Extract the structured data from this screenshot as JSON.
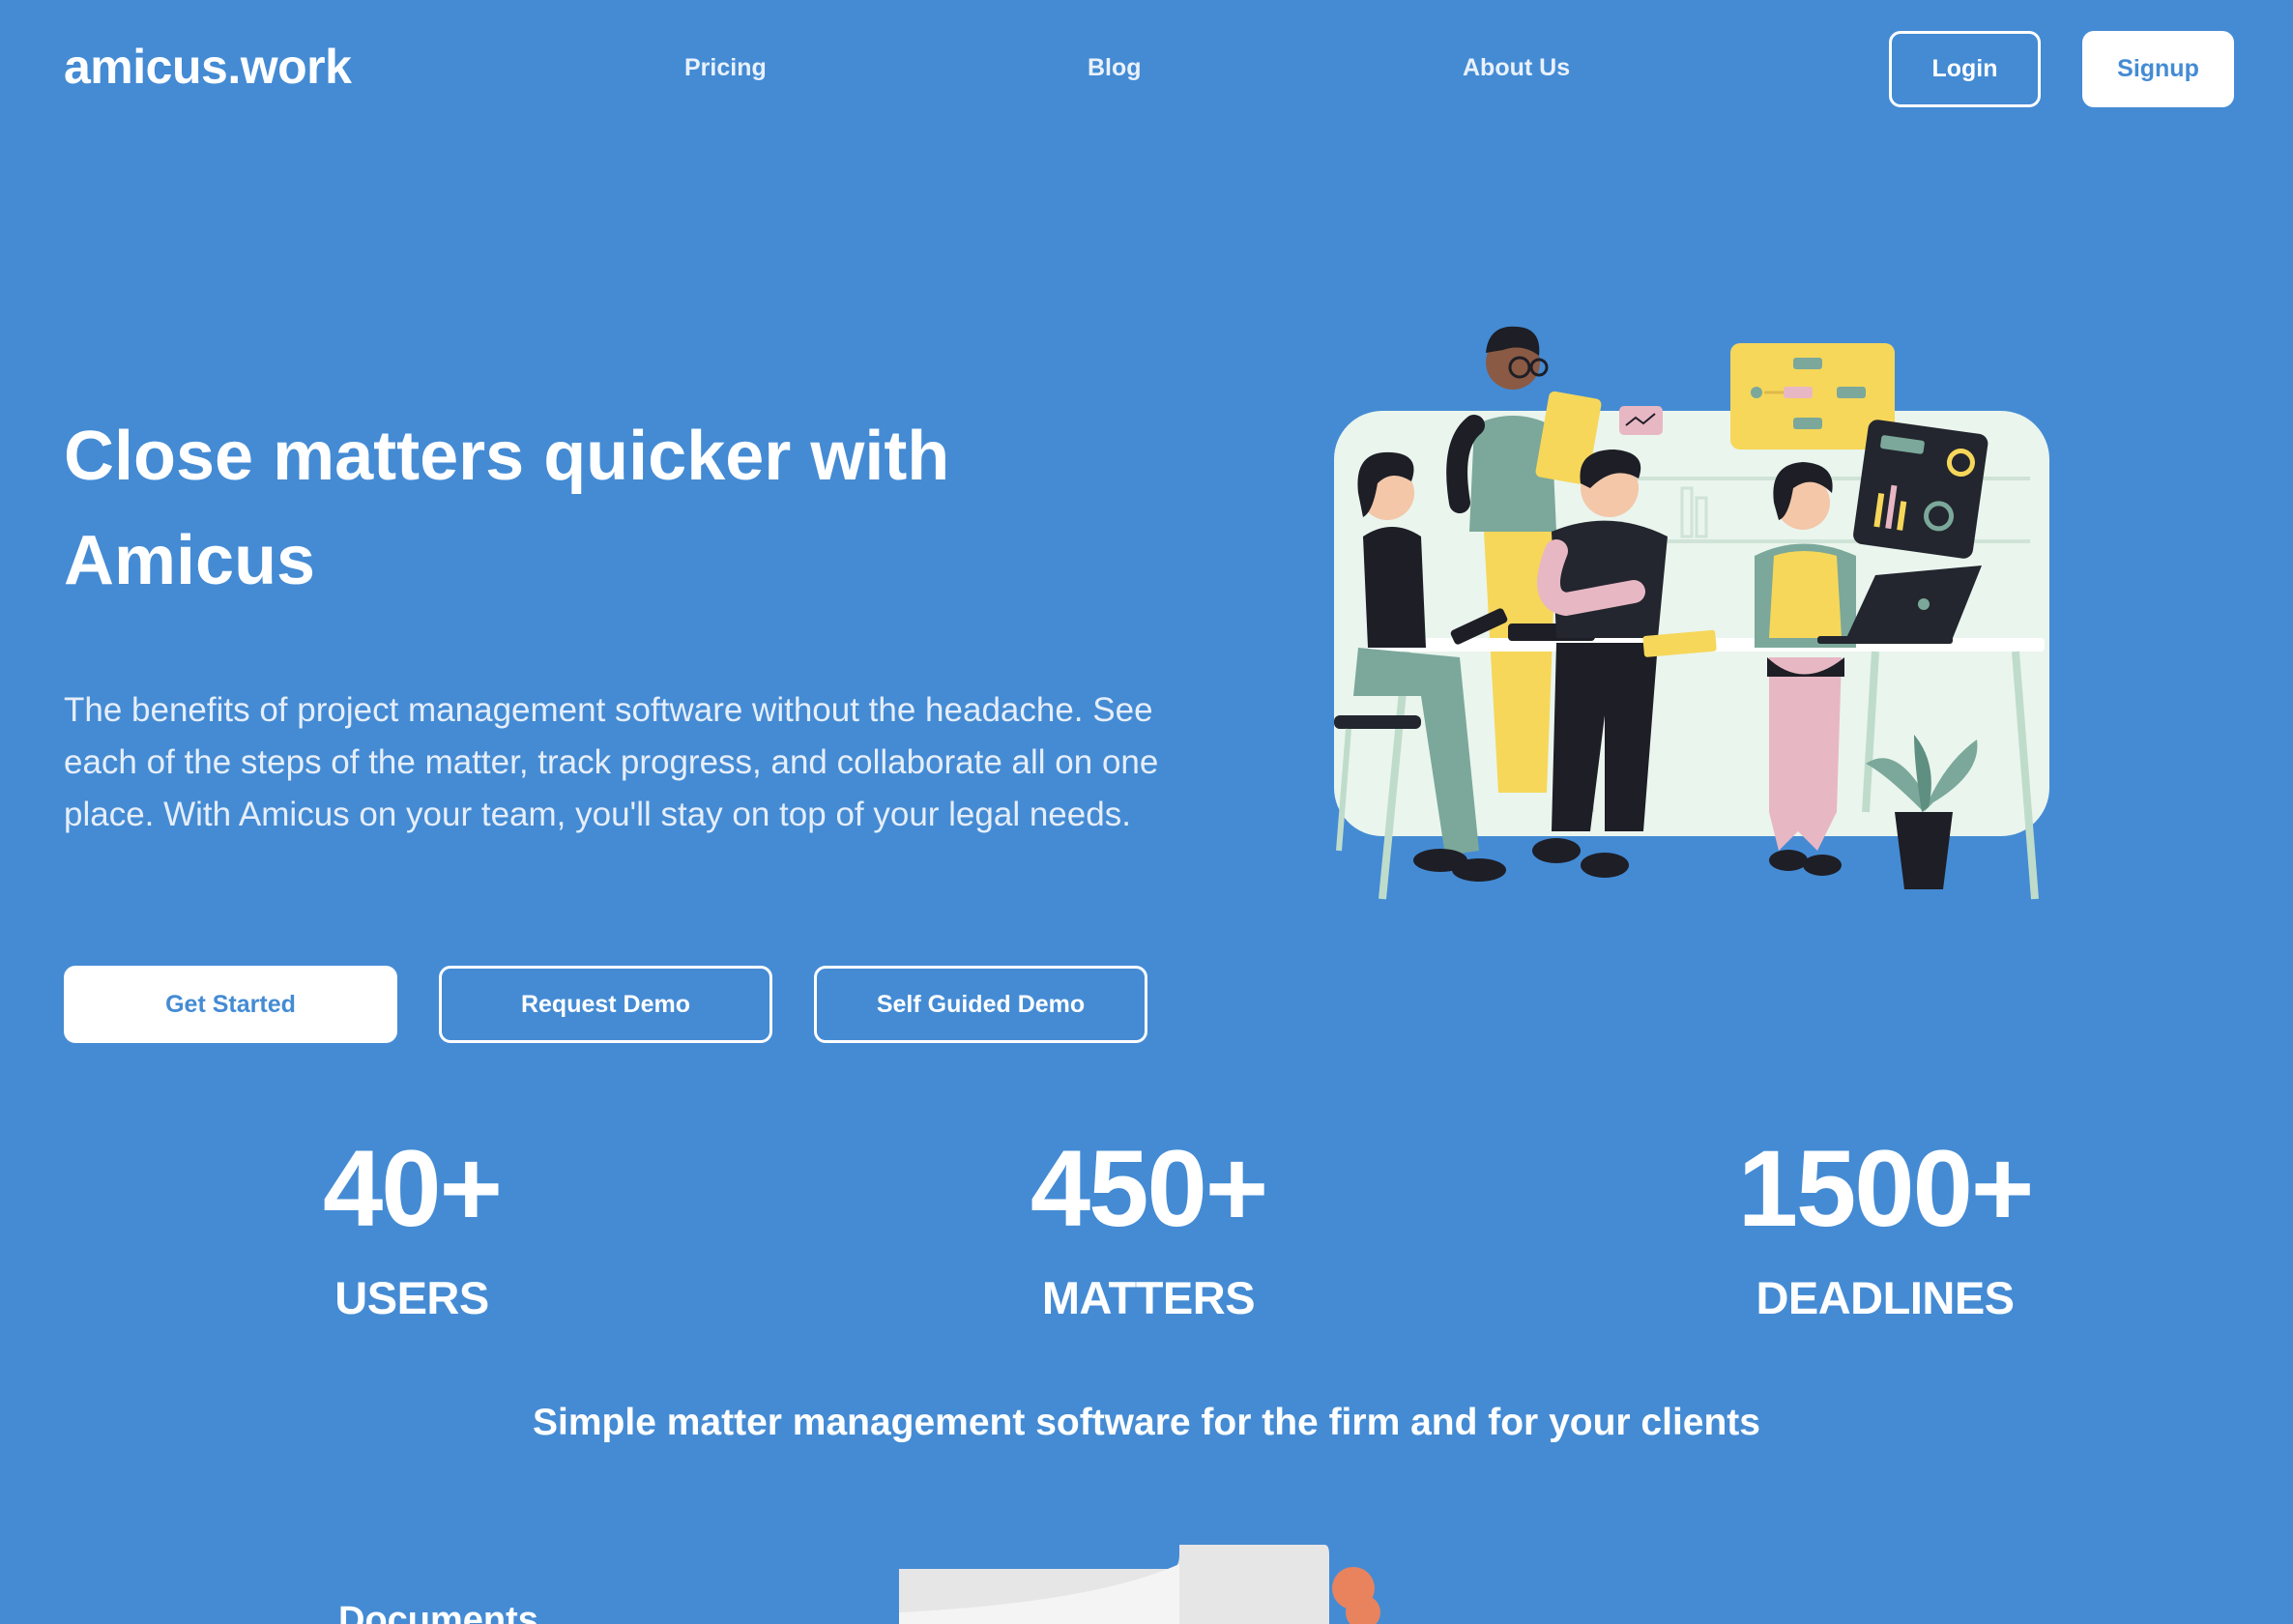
{
  "nav": {
    "logo": "amicus.work",
    "links": [
      "Pricing",
      "Blog",
      "About Us"
    ],
    "login": "Login",
    "signup": "Signup"
  },
  "hero": {
    "title_line1": "Close matters quicker with",
    "title_line2": "Amicus",
    "description": "The benefits of project management software without the headache. See each of the steps of the matter, track progress, and collaborate all on one place. With Amicus on your team, you'll stay on top of your legal needs.",
    "buttons": {
      "get_started": "Get Started",
      "request_demo": "Request Demo",
      "self_guided": "Self Guided Demo"
    }
  },
  "stats": [
    {
      "value": "40+",
      "label": "USERS"
    },
    {
      "value": "450+",
      "label": "MATTERS"
    },
    {
      "value": "1500+",
      "label": "DEADLINES"
    }
  ],
  "tagline": "Simple matter management software for the firm and for your clients",
  "features": {
    "first_heading": "Documents"
  },
  "colors": {
    "background": "#448BD4",
    "button_text": "#448BD4",
    "white": "#FFFFFF"
  }
}
